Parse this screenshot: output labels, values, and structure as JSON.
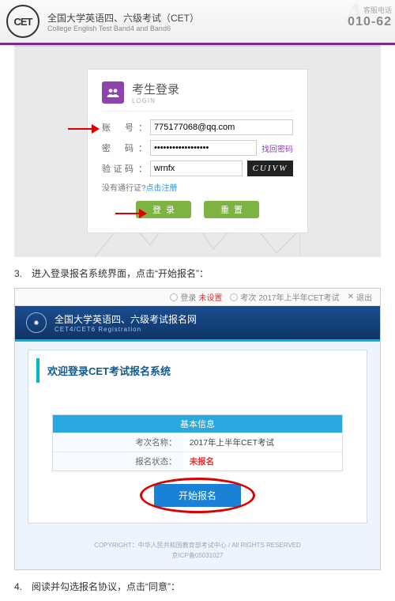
{
  "header": {
    "logo_text": "CET",
    "title_cn": "全国大学英语四、六级考试（CET）",
    "title_en": "College English Test Band4 and Band6",
    "phone_label": "客服电话",
    "phone": "010-62",
    "watermark": "A"
  },
  "login": {
    "title_cn": "考生登录",
    "title_en": "LOGIN",
    "account_label": "账　号",
    "account_value": "775177068@qq.com",
    "password_label": "密　码",
    "password_value": "••••••••••••••••••",
    "find_pwd": "找回密码",
    "captcha_label": "验证码",
    "captcha_value": "wrnfx",
    "captcha_img": "CUIVW",
    "no_account_prefix": "没有通行证?",
    "register_link": "点击注册",
    "btn_login": "登录",
    "btn_reset": "重置",
    "colon": "："
  },
  "step3": {
    "text": "3.　进入登录报名系统界面，点击“开始报名”："
  },
  "s2": {
    "topbar": {
      "login_label": "登录",
      "login_status": "未设置",
      "exam_label": "考次",
      "exam_value": "2017年上半年CET考试",
      "logout": "退出"
    },
    "brand_cn": "全国大学英语四、六级考试报名网",
    "brand_en": "CET4/CET6  Registration",
    "welcome": "欢迎登录CET考试报名系统",
    "info_head": "基本信息",
    "rows": {
      "exam_k": "考次名称：",
      "exam_v": "2017年上半年CET考试",
      "status_k": "报名状态：",
      "status_v": "未报名"
    },
    "start_btn": "开始报名",
    "footer1": "COPYRIGHT：中华人民共和国教育部考试中心 / All RIGHTS RESERVED",
    "footer2": "京ICP备05031027"
  },
  "step4": {
    "text": "4.　阅读并勾选报名协议，点击“同意”："
  }
}
